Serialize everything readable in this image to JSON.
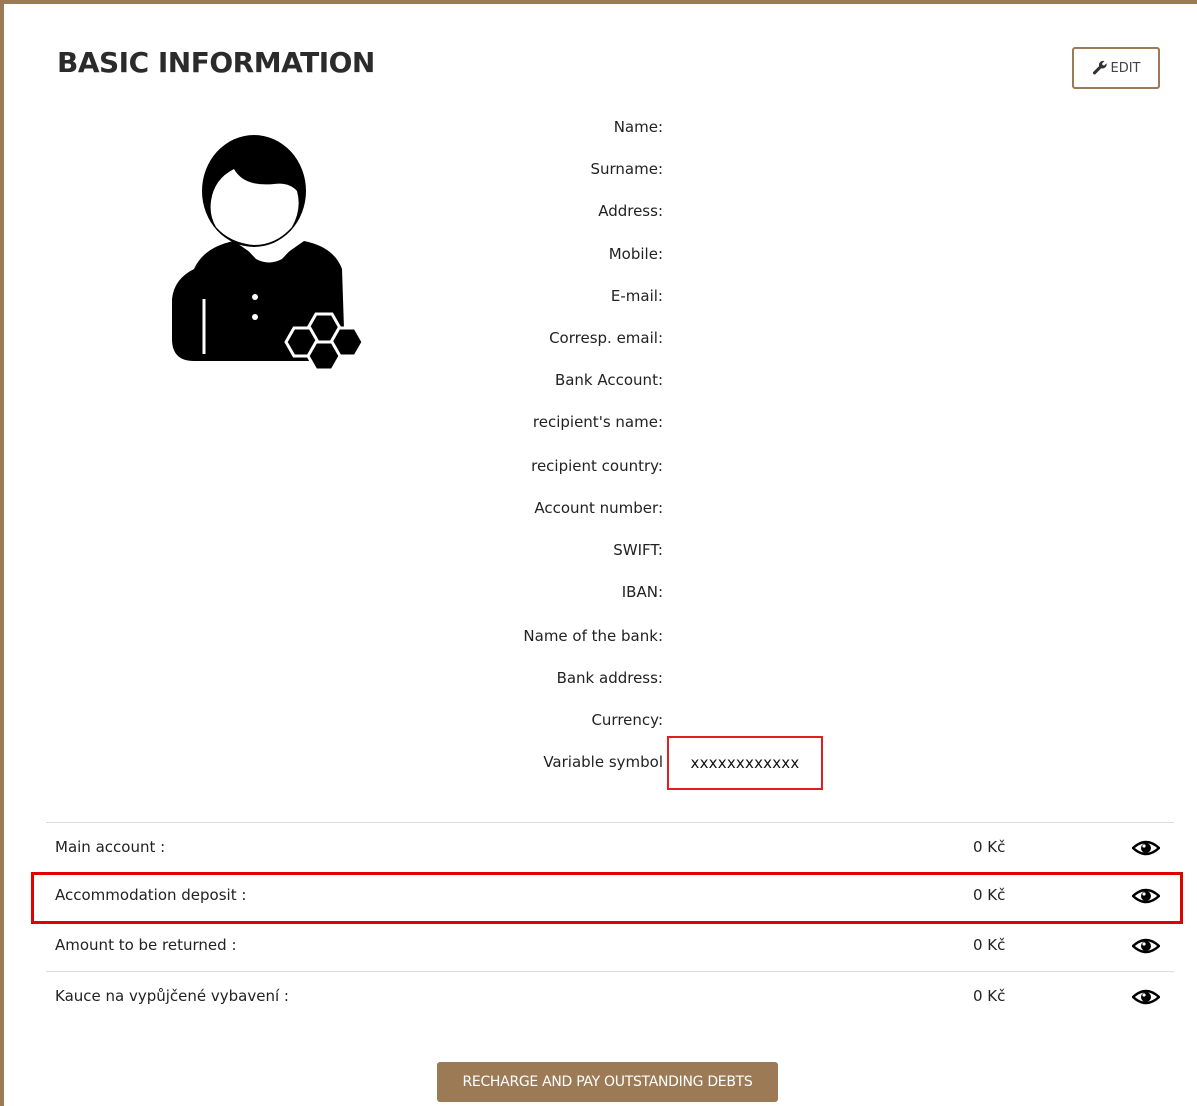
{
  "page": {
    "title": "BASIC INFORMATION",
    "edit_label": "EDIT"
  },
  "fields": [
    {
      "label": "Name:"
    },
    {
      "label": "Surname:"
    },
    {
      "label": "Address:"
    },
    {
      "label": "Mobile:"
    },
    {
      "label": "E-mail:"
    },
    {
      "label": "Corresp. email:"
    },
    {
      "label": "Bank Account:"
    },
    {
      "label": "recipient's name:"
    },
    {
      "label": "recipient country:"
    },
    {
      "label": "Account number:"
    },
    {
      "label": "SWIFT:"
    },
    {
      "label": "IBAN:"
    },
    {
      "label": "Name of the bank:"
    },
    {
      "label": "Bank address:"
    },
    {
      "label": "Currency:"
    },
    {
      "label": "Variable symbol",
      "value": "xxxxxxxxxxxx"
    }
  ],
  "accounts": [
    {
      "label": "Main account :",
      "value": "0 Kč"
    },
    {
      "label": "Accommodation deposit :",
      "value": "0 Kč"
    },
    {
      "label": "Amount to be returned :",
      "value": "0 Kč"
    },
    {
      "label": "Kauce na vypůjčené vybavení :",
      "value": "0 Kč"
    }
  ],
  "actions": {
    "recharge_label": "RECHARGE AND PAY OUTSTANDING DEBTS"
  },
  "colors": {
    "accent": "#9c7a55",
    "highlight": "#e00000"
  },
  "icons": {
    "edit": "wrench-icon",
    "avatar": "user-avatar-icon",
    "view": "eye-icon"
  }
}
